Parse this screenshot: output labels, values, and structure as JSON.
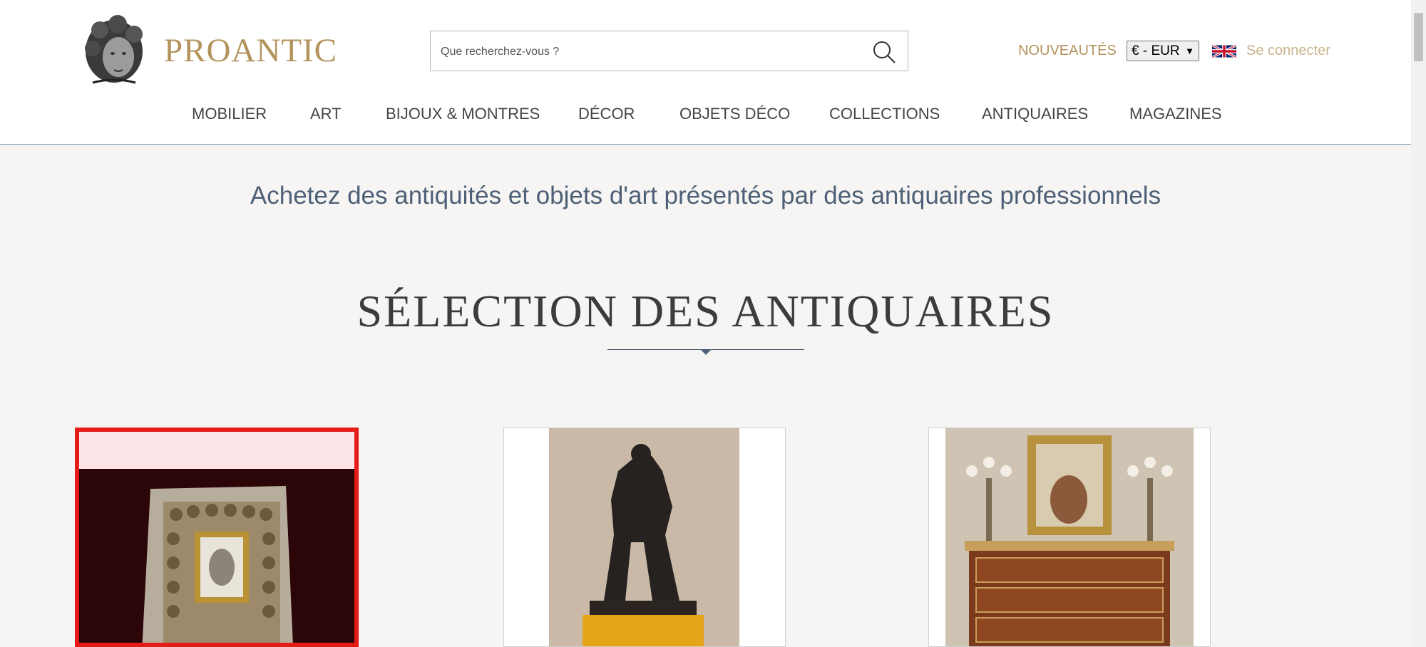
{
  "brand": {
    "name": "PROANTIC",
    "accent": "#b3935c"
  },
  "search": {
    "placeholder": "Que recherchez-vous ?",
    "icon": "search-icon"
  },
  "top_links": {
    "nouveautes": "NOUVEAUTÉS",
    "currency": "€ - EUR",
    "language_icon": "uk-flag-icon",
    "login": "Se connecter"
  },
  "nav": {
    "items": [
      {
        "label": "MOBILIER"
      },
      {
        "label": "ART"
      },
      {
        "label": "BIJOUX & MONTRES"
      },
      {
        "label": "DÉCOR"
      },
      {
        "label": "OBJETS DÉCO"
      },
      {
        "label": "COLLECTIONS"
      },
      {
        "label": "ANTIQUAIRES"
      },
      {
        "label": "MAGAZINES"
      }
    ]
  },
  "tagline": "Achetez des antiquités et objets d'art présentés par des antiquaires professionnels",
  "selection": {
    "title": "SÉLECTION DES ANTIQUAIRES",
    "cards": [
      {
        "image": "framed-religious-engraving-image",
        "highlighted": true
      },
      {
        "image": "bronze-hercules-statue-image",
        "highlighted": false
      },
      {
        "image": "louis-xvi-commode-with-candelabra-image",
        "highlighted": false
      }
    ]
  },
  "colors": {
    "highlight": "#e41b17",
    "nav_text": "#444444",
    "tagline": "#4d6077"
  }
}
